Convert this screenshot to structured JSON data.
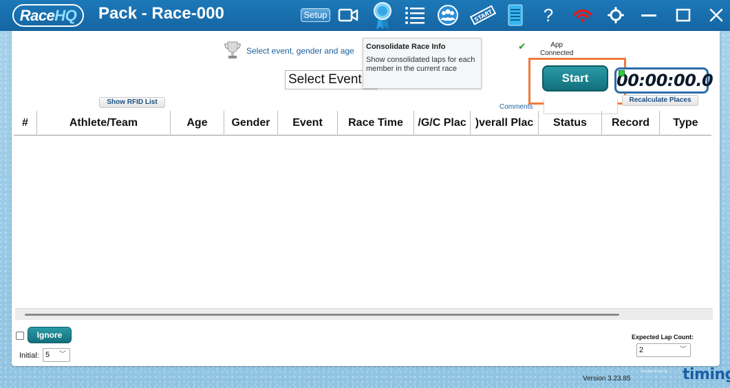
{
  "titlebar": {
    "logo_race": "Race",
    "logo_hq": "HQ",
    "title": "Pack - Race-000",
    "setup_label": "Setup",
    "help_label": "?",
    "icons": [
      "camera-icon",
      "ribbon-icon",
      "list-icon",
      "team-icon",
      "start-flag-icon",
      "document-icon",
      "help-icon",
      "wifi-icon",
      "gear-icon",
      "minimize-icon",
      "maximize-icon",
      "close-icon"
    ]
  },
  "toolbar": {
    "select_hint": "Select event, gender and age",
    "app_status_line1": "App",
    "app_status_line2": "Connected",
    "event_select_value": "Select Event",
    "start_label": "Start",
    "timer_value": "00:00:00.0",
    "comments_label": "Comments",
    "rfid_label": "Show RFID List",
    "recalc_label": "Recalculate Places"
  },
  "tooltip": {
    "title": "Consolidate Race Info",
    "body": "Show consolidated laps for each member in the current race"
  },
  "table": {
    "columns": [
      "#",
      "Athlete/Team",
      "Age",
      "Gender",
      "Event",
      "Race Time",
      "/G/C Plac",
      ")verall Plac",
      "Status",
      "Record",
      "Type"
    ],
    "rows": []
  },
  "footer": {
    "ignore_label": "Ignore",
    "initial_label": "Initial:",
    "initial_value": "5",
    "lap_count_label": "Expected Lap Count:",
    "lap_count_value": "2",
    "version": "Version 3.23.85",
    "brought_by": "brought to you by",
    "brand": "timing"
  },
  "colors": {
    "titlebar": "#1566a3",
    "accent_teal": "#12707c",
    "highlight": "#f07a3a",
    "timer_border": "#2b6da8"
  }
}
